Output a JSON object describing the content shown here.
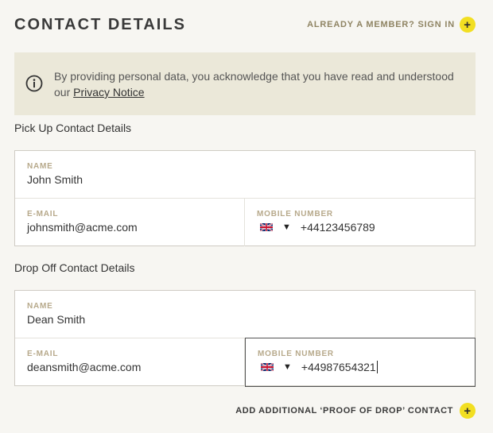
{
  "header": {
    "title": "CONTACT DETAILS",
    "signin_label": "ALREADY A MEMBER? SIGN IN",
    "plus_glyph": "+"
  },
  "notice": {
    "text": "By providing personal data, you acknowledge that you have read and understood our ",
    "link_label": "Privacy Notice"
  },
  "pickup": {
    "section_label": "Pick Up Contact Details",
    "name_label": "NAME",
    "name_value": "John Smith",
    "email_label": "E-MAIL",
    "email_value": "johnsmith@acme.com",
    "mobile_label": "MOBILE NUMBER",
    "country_flag": "uk-flag-icon",
    "caret": "▼",
    "mobile_value": "+44123456789"
  },
  "dropoff": {
    "section_label": "Drop Off Contact Details",
    "name_label": "NAME",
    "name_value": "Dean Smith",
    "email_label": "E-MAIL",
    "email_value": "deansmith@acme.com",
    "mobile_label": "MOBILE NUMBER",
    "country_flag": "uk-flag-icon",
    "caret": "▼",
    "mobile_value": "+44987654321"
  },
  "footer": {
    "add_contact_label": "ADD ADDITIONAL ‘PROOF OF DROP’ CONTACT",
    "plus_glyph": "+"
  },
  "colors": {
    "accent": "#f2df22",
    "label_gold": "#b7a98b",
    "notice_bg": "#ebe8d9",
    "page_bg": "#f7f6f2"
  }
}
